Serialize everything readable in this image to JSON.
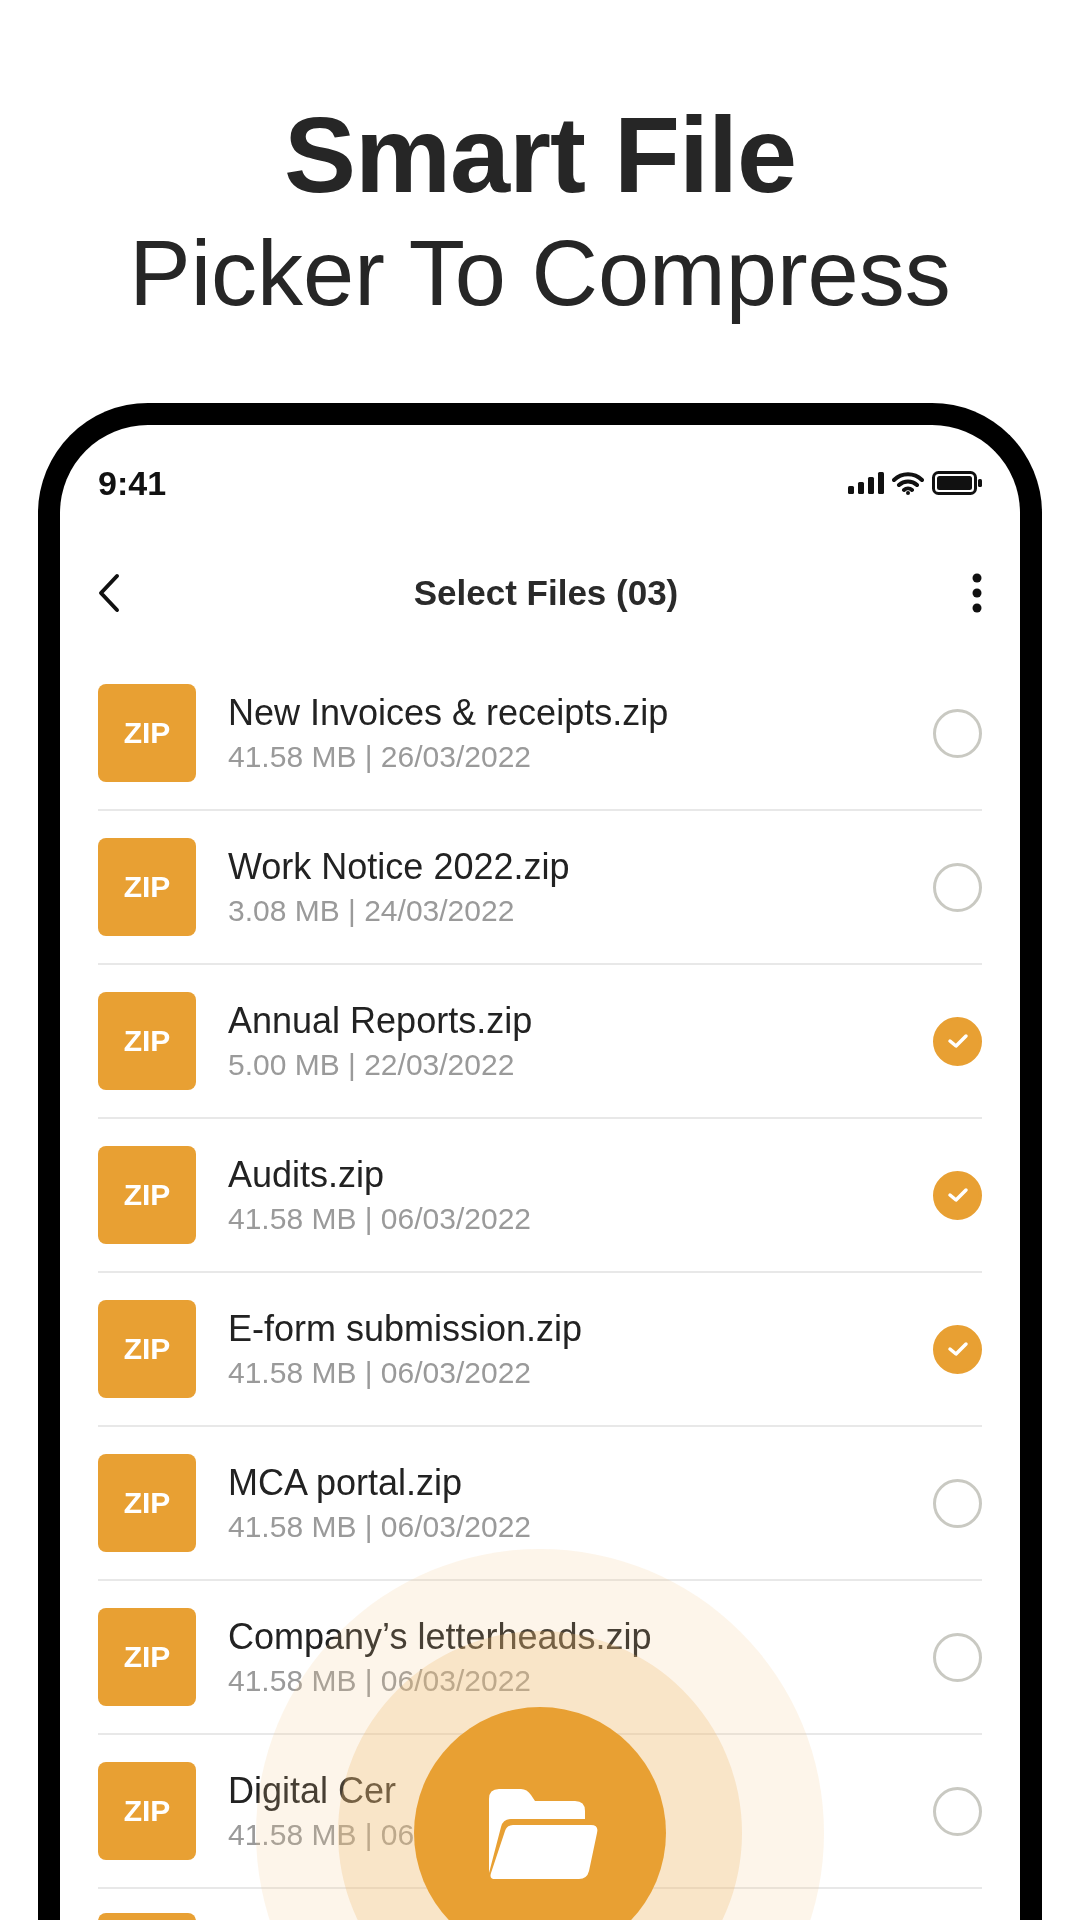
{
  "headline": {
    "title": "Smart File",
    "subtitle": "Picker To Compress"
  },
  "status_bar": {
    "time": "9:41"
  },
  "app_bar": {
    "title": "Select Files (03)"
  },
  "files": [
    {
      "kind": "row",
      "badge": "ZIP",
      "name": "New Invoices & receipts.zip",
      "meta": "41.58 MB | 26/03/2022",
      "checked": false
    },
    {
      "kind": "row",
      "badge": "ZIP",
      "name": "Work Notice 2022.zip",
      "meta": "3.08 MB | 24/03/2022",
      "checked": false
    },
    {
      "kind": "row",
      "badge": "ZIP",
      "name": "Annual Reports.zip",
      "meta": "5.00 MB | 22/03/2022",
      "checked": true
    },
    {
      "kind": "row",
      "badge": "ZIP",
      "name": "Audits.zip",
      "meta": "41.58 MB | 06/03/2022",
      "checked": true
    },
    {
      "kind": "row",
      "badge": "ZIP",
      "name": "E-form submission.zip",
      "meta": "41.58 MB | 06/03/2022",
      "checked": true
    },
    {
      "kind": "row",
      "badge": "ZIP",
      "name": "MCA portal.zip",
      "meta": "41.58 MB | 06/03/2022",
      "checked": false
    },
    {
      "kind": "row",
      "badge": "ZIP",
      "name": "Company’s letterheads.zip",
      "meta": "41.58 MB | 06/03/2022",
      "checked": false
    },
    {
      "kind": "row",
      "badge": "ZIP",
      "name": "Digital Cer",
      "meta": "41.58 MB | 06",
      "checked": false
    },
    {
      "kind": "cut"
    }
  ]
}
